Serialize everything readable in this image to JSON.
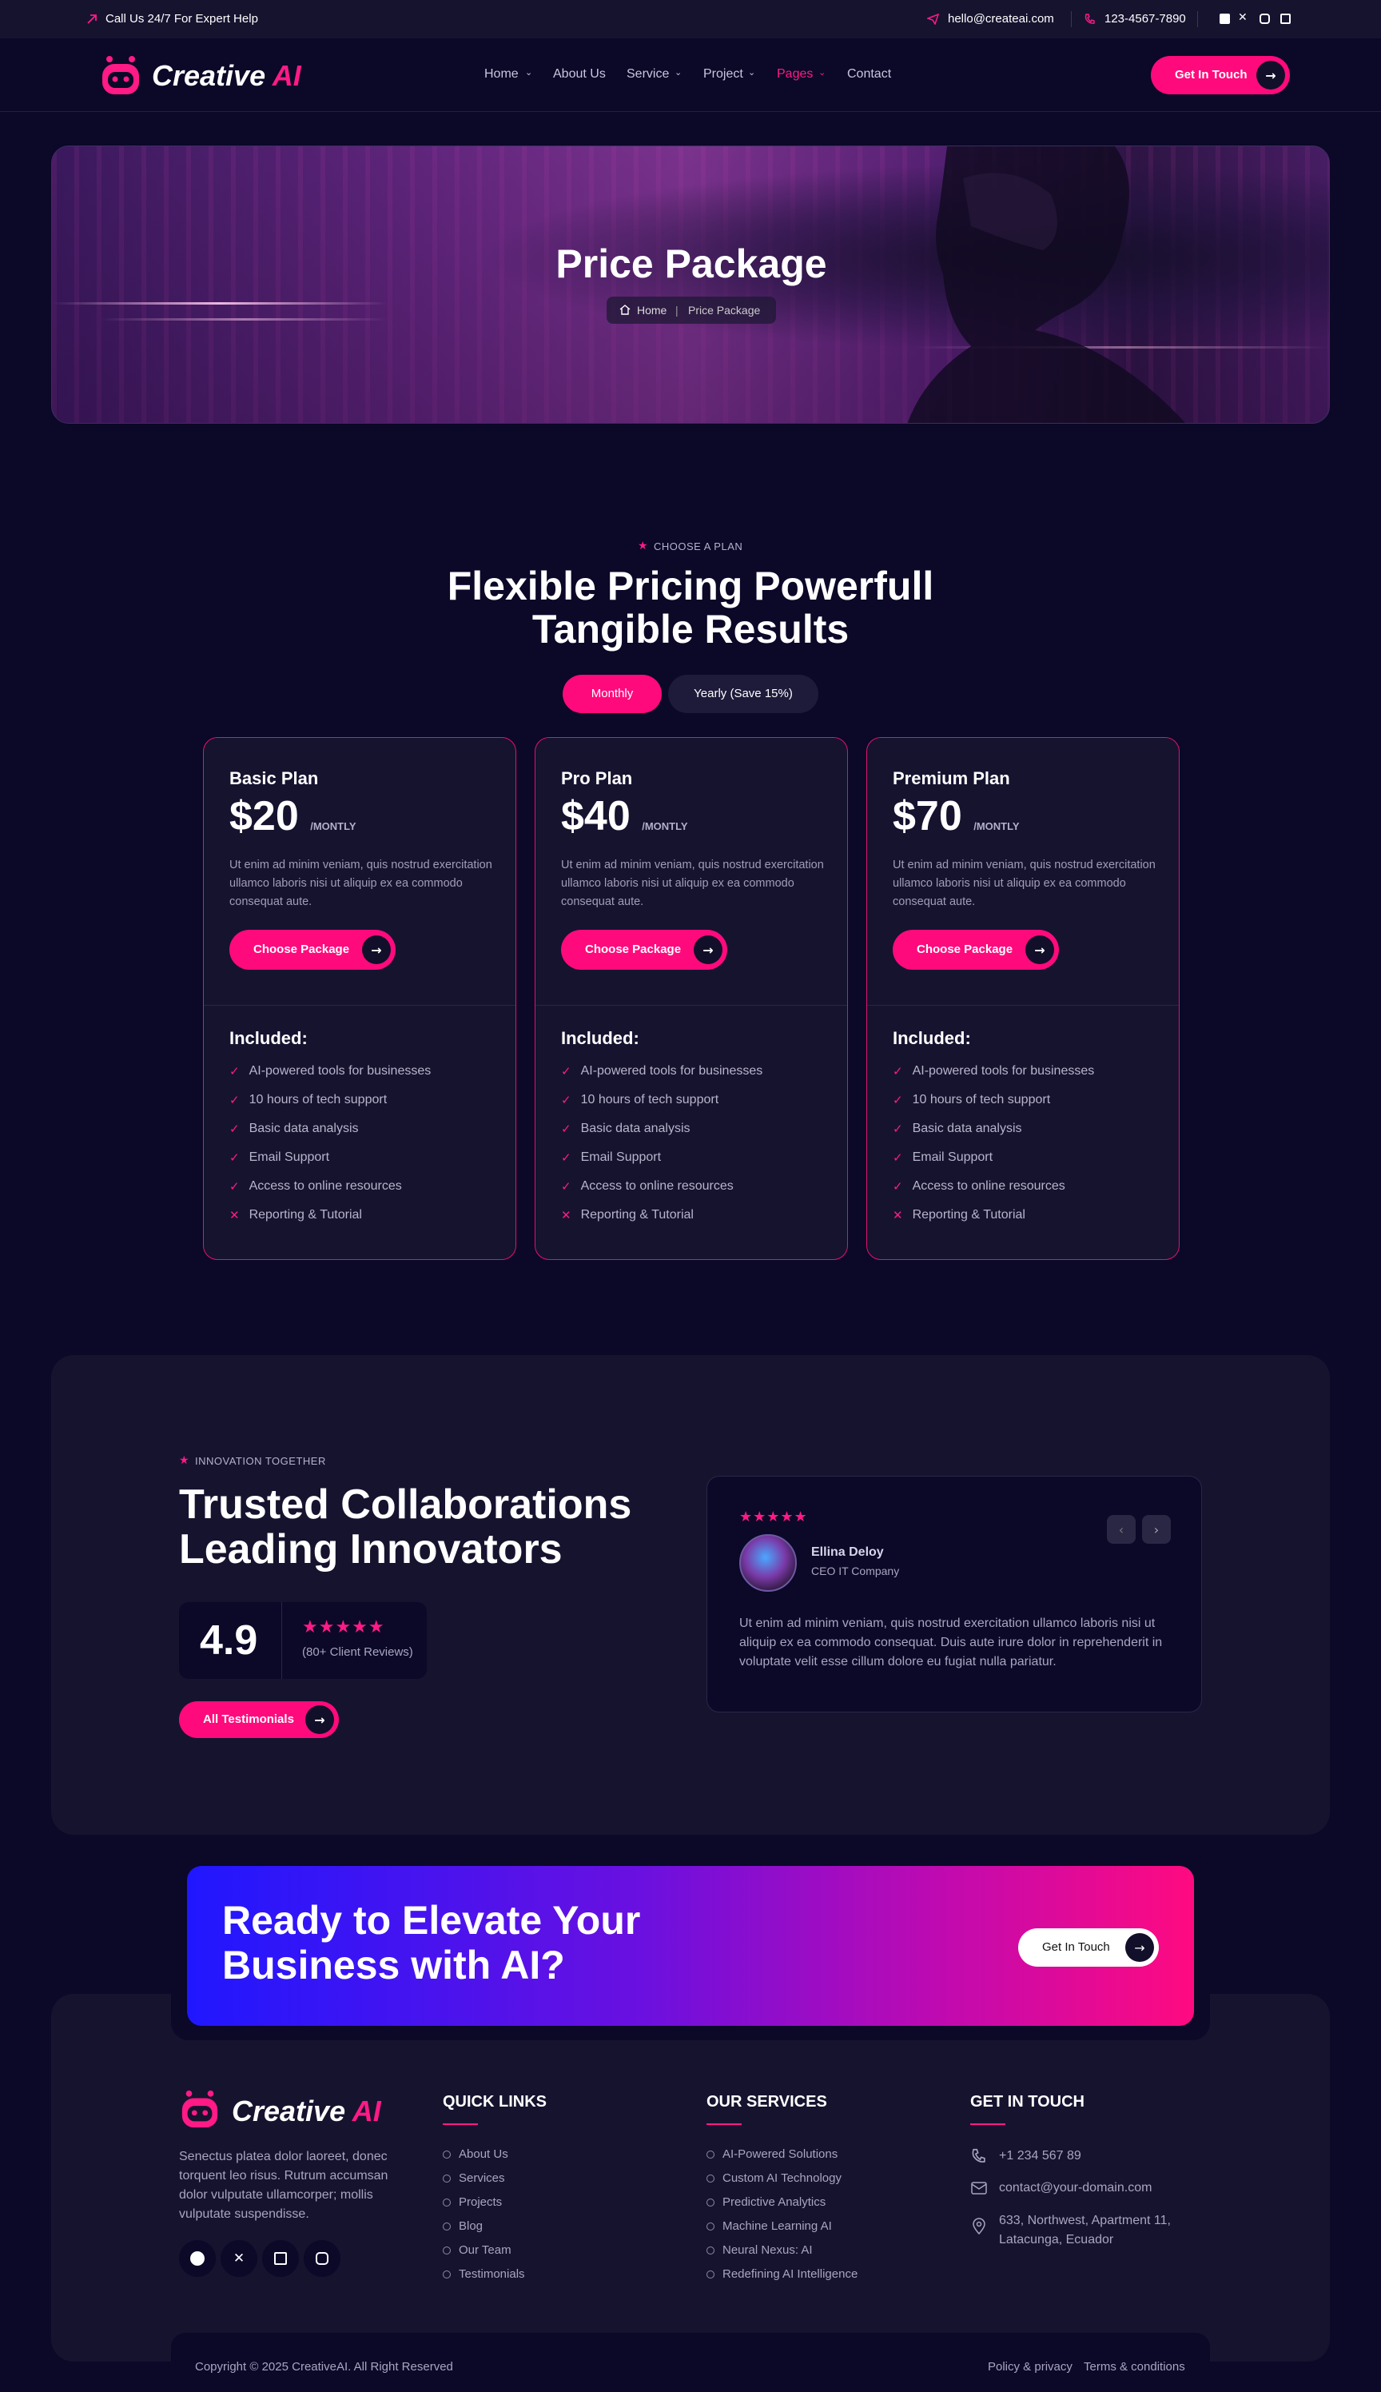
{
  "topbar": {
    "help_text": "Call Us 24/7 For Expert Help",
    "email": "hello@createai.com",
    "phone": "123-4567-7890",
    "social_icons": [
      "facebook-icon",
      "x-icon",
      "instagram-icon",
      "linkedin-icon"
    ]
  },
  "brand": {
    "name_main": "Creative",
    "name_accent": "AI",
    "accent_color": "#ff1a86"
  },
  "nav": {
    "items": [
      {
        "label": "Home",
        "dropdown": true
      },
      {
        "label": "About Us",
        "dropdown": false
      },
      {
        "label": "Service",
        "dropdown": true
      },
      {
        "label": "Project",
        "dropdown": true
      },
      {
        "label": "Pages",
        "dropdown": true,
        "active": true
      },
      {
        "label": "Contact",
        "dropdown": false
      }
    ],
    "cta_label": "Get In Touch"
  },
  "hero": {
    "title": "Price Package",
    "breadcrumb_home": "Home",
    "breadcrumb_separator": "|",
    "breadcrumb_current": "Price Package"
  },
  "pricing": {
    "kicker": "CHOOSE A PLAN",
    "title_line1": "Flexible Pricing Powerfull",
    "title_line2": "Tangible Results",
    "toggle_monthly": "Monthly",
    "toggle_yearly": "Yearly (Save 15%)",
    "plans": [
      {
        "name": "Basic Plan",
        "price": "$20",
        "period": "/MONTLY",
        "desc": "Ut enim ad minim veniam, quis nostrud exercitation ullamco laboris nisi ut aliquip ex ea commodo consequat aute.",
        "button": "Choose Package",
        "included_label": "Included:"
      },
      {
        "name": "Pro Plan",
        "price": "$40",
        "period": "/MONTLY",
        "desc": "Ut enim ad minim veniam, quis nostrud exercitation ullamco laboris nisi ut aliquip ex ea commodo consequat aute.",
        "button": "Choose Package",
        "included_label": "Included:"
      },
      {
        "name": "Premium Plan",
        "price": "$70",
        "period": "/MONTLY",
        "desc": "Ut enim ad minim veniam, quis nostrud exercitation ullamco laboris nisi ut aliquip ex ea commodo consequat aute.",
        "button": "Choose Package",
        "included_label": "Included:"
      }
    ],
    "features": [
      {
        "text": "AI-powered tools for businesses",
        "included": true
      },
      {
        "text": "10 hours of tech support",
        "included": true
      },
      {
        "text": "Basic data analysis",
        "included": true
      },
      {
        "text": "Email Support",
        "included": true
      },
      {
        "text": "Access to online resources",
        "included": true
      },
      {
        "text": "Reporting & Tutorial",
        "included": false
      }
    ]
  },
  "testimonials": {
    "kicker": "INNOVATION TOGETHER",
    "title_line1": "Trusted Collaborations",
    "title_line2": "Leading Innovators",
    "rating": "4.9",
    "stars": 5,
    "reviews_text": "(80+ Client Reviews)",
    "button": "All Testimonials",
    "review": {
      "stars": 5,
      "name": "Ellina Deloy",
      "role": "CEO IT Company",
      "text": "Ut enim ad minim veniam, quis nostrud exercitation ullamco laboris nisi ut aliquip ex ea commodo consequat. Duis aute irure dolor in reprehenderit in voluptate velit esse cillum dolore eu fugiat nulla pariatur."
    }
  },
  "cta": {
    "title_line1": "Ready to Elevate Your",
    "title_line2": "Business with AI?",
    "button": "Get In Touch"
  },
  "footer": {
    "about": "Senectus platea dolor laoreet, donec torquent leo risus. Rutrum accumsan dolor vulputate ullamcorper; mollis vulputate suspendisse.",
    "quick_links_title": "QUICK LINKS",
    "quick_links": [
      "About Us",
      "Services",
      "Projects",
      "Blog",
      "Our Team",
      "Testimonials"
    ],
    "services_title": "OUR SERVICES",
    "services": [
      "AI-Powered Solutions",
      "Custom AI Technology",
      "Predictive Analytics",
      "Machine Learning AI",
      "Neural Nexus: AI",
      "Redefining AI Intelligence"
    ],
    "contact_title": "GET IN TOUCH",
    "phone": "+1 234 567 89",
    "email": "contact@your-domain.com",
    "address_line1": "633, Northwest, Apartment 11,",
    "address_line2": "Latacunga, Ecuador",
    "copyright": "Copyright © 2025 CreativeAI. All Right Reserved",
    "policy": "Policy & privacy",
    "terms": "Terms & conditions"
  }
}
